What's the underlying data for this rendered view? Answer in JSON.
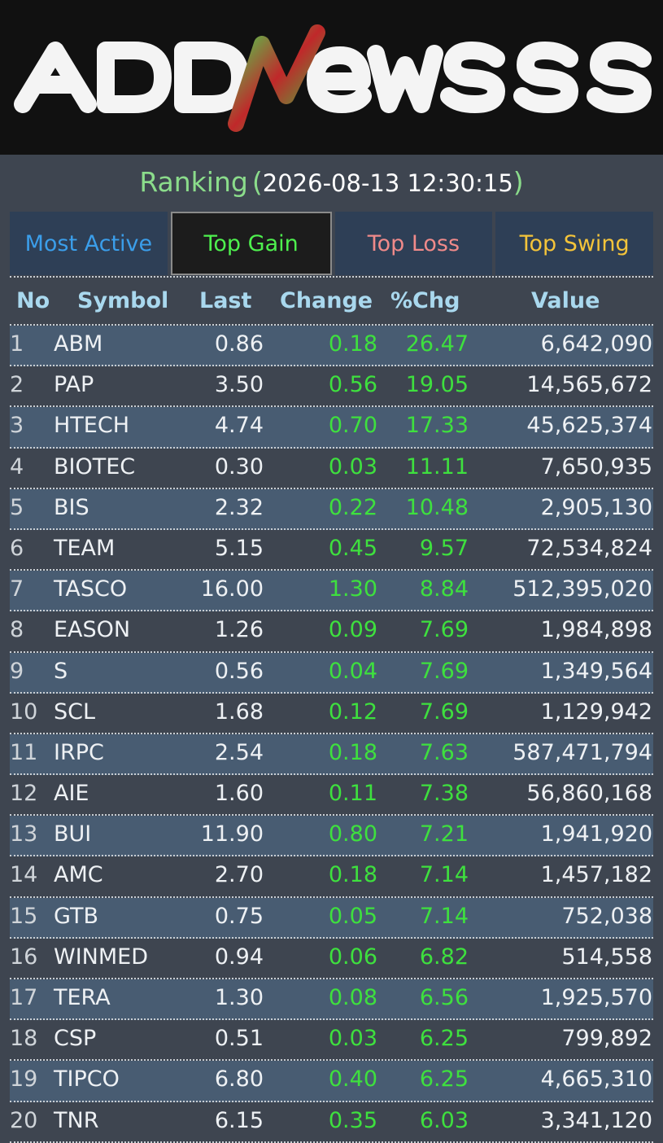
{
  "logo": {
    "text": "ADDNeWSS"
  },
  "title": {
    "label": "Ranking",
    "timestamp": "2026-08-13 12:30:15"
  },
  "tabs": [
    {
      "label": "Most Active",
      "active": false
    },
    {
      "label": "Top Gain",
      "active": true
    },
    {
      "label": "Top Loss",
      "active": false
    },
    {
      "label": "Top Swing",
      "active": false
    }
  ],
  "columns": {
    "no": "No",
    "symbol": "Symbol",
    "last": "Last",
    "change": "Change",
    "pct": "%Chg",
    "value": "Value"
  },
  "rows": [
    {
      "no": "1",
      "symbol": "ABM",
      "last": "0.86",
      "change": "0.18",
      "pct": "26.47",
      "value": "6,642,090"
    },
    {
      "no": "2",
      "symbol": "PAP",
      "last": "3.50",
      "change": "0.56",
      "pct": "19.05",
      "value": "14,565,672"
    },
    {
      "no": "3",
      "symbol": "HTECH",
      "last": "4.74",
      "change": "0.70",
      "pct": "17.33",
      "value": "45,625,374"
    },
    {
      "no": "4",
      "symbol": "BIOTEC",
      "last": "0.30",
      "change": "0.03",
      "pct": "11.11",
      "value": "7,650,935"
    },
    {
      "no": "5",
      "symbol": "BIS",
      "last": "2.32",
      "change": "0.22",
      "pct": "10.48",
      "value": "2,905,130"
    },
    {
      "no": "6",
      "symbol": "TEAM",
      "last": "5.15",
      "change": "0.45",
      "pct": "9.57",
      "value": "72,534,824"
    },
    {
      "no": "7",
      "symbol": "TASCO",
      "last": "16.00",
      "change": "1.30",
      "pct": "8.84",
      "value": "512,395,020"
    },
    {
      "no": "8",
      "symbol": "EASON",
      "last": "1.26",
      "change": "0.09",
      "pct": "7.69",
      "value": "1,984,898"
    },
    {
      "no": "9",
      "symbol": "S",
      "last": "0.56",
      "change": "0.04",
      "pct": "7.69",
      "value": "1,349,564"
    },
    {
      "no": "10",
      "symbol": "SCL",
      "last": "1.68",
      "change": "0.12",
      "pct": "7.69",
      "value": "1,129,942"
    },
    {
      "no": "11",
      "symbol": "IRPC",
      "last": "2.54",
      "change": "0.18",
      "pct": "7.63",
      "value": "587,471,794"
    },
    {
      "no": "12",
      "symbol": "AIE",
      "last": "1.60",
      "change": "0.11",
      "pct": "7.38",
      "value": "56,860,168"
    },
    {
      "no": "13",
      "symbol": "BUI",
      "last": "11.90",
      "change": "0.80",
      "pct": "7.21",
      "value": "1,941,920"
    },
    {
      "no": "14",
      "symbol": "AMC",
      "last": "2.70",
      "change": "0.18",
      "pct": "7.14",
      "value": "1,457,182"
    },
    {
      "no": "15",
      "symbol": "GTB",
      "last": "0.75",
      "change": "0.05",
      "pct": "7.14",
      "value": "752,038"
    },
    {
      "no": "16",
      "symbol": "WINMED",
      "last": "0.94",
      "change": "0.06",
      "pct": "6.82",
      "value": "514,558"
    },
    {
      "no": "17",
      "symbol": "TERA",
      "last": "1.30",
      "change": "0.08",
      "pct": "6.56",
      "value": "1,925,570"
    },
    {
      "no": "18",
      "symbol": "CSP",
      "last": "0.51",
      "change": "0.03",
      "pct": "6.25",
      "value": "799,892"
    },
    {
      "no": "19",
      "symbol": "TIPCO",
      "last": "6.80",
      "change": "0.40",
      "pct": "6.25",
      "value": "4,665,310"
    },
    {
      "no": "20",
      "symbol": "TNR",
      "last": "6.15",
      "change": "0.35",
      "pct": "6.03",
      "value": "3,341,120"
    }
  ],
  "colors": {
    "gain": "#3ee03e",
    "header": "#a9d8ee",
    "title": "#8bdc8b",
    "row_alt": "#485c72"
  }
}
